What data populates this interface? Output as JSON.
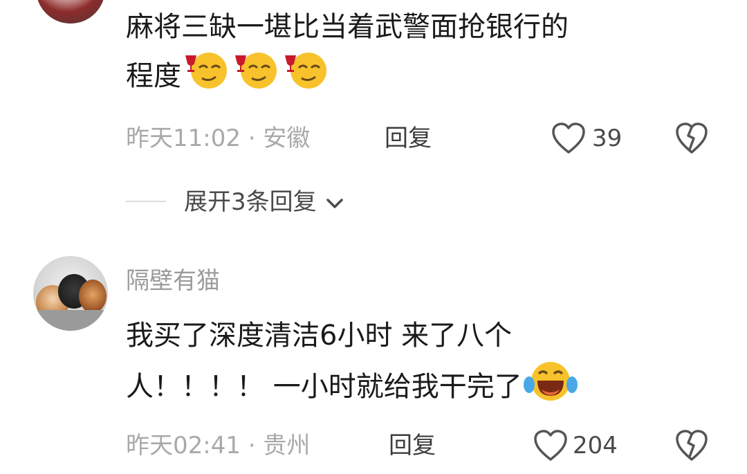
{
  "comment1": {
    "text_line1": "麻将三缺一堪比当着武警面抢银行的",
    "text_line2": "程度",
    "emoji_names": [
      "smirk-wine-emoji",
      "smirk-wine-emoji",
      "smirk-wine-emoji"
    ],
    "meta": "昨天11:02 · 安徽",
    "reply_label": "回复",
    "likes": "39",
    "expand_replies": "展开3条回复"
  },
  "comment2": {
    "username": "隔壁有猫",
    "text_line1": "我买了深度清洁6小时 来了八个",
    "text_line2": "人！！！！ 一小时就给我干完了",
    "emoji_name": "laughing-tears-emoji",
    "meta": "昨天02:41 · 贵州",
    "reply_label": "回复",
    "likes": "204"
  }
}
